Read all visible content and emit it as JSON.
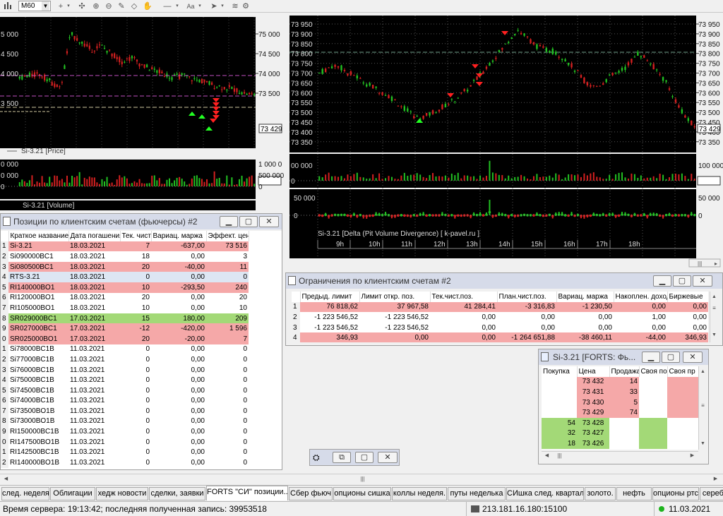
{
  "toolbar": {
    "timeframe": "M60"
  },
  "left_chart": {
    "price_legend": "Si-3.21 [Price]",
    "volume_legend": "Si-3.21 [Volume]",
    "y_ticks_right": [
      "75 000",
      "74 500",
      "74 000",
      "73 500"
    ],
    "y_ticks_left": [
      "5 000",
      "4 500",
      "4 000",
      "3 500"
    ],
    "last_price": "73 429",
    "volume_ticks_right": [
      "1 000 0",
      "500 000",
      "0"
    ],
    "volume_ticks_left": [
      "0 000",
      "0 000",
      "0"
    ]
  },
  "right_chart": {
    "y_ticks": [
      "73 950",
      "73 900",
      "73 850",
      "73 800",
      "73 750",
      "73 700",
      "73 650",
      "73 600",
      "73 550",
      "73 500",
      "73 450",
      "73 400",
      "73 350"
    ],
    "last_price": "73 429",
    "volume_ticks": [
      "100 000",
      "0"
    ],
    "volume_ticks_left": [
      "00 000",
      "0"
    ],
    "delta_ticks": [
      "50 000",
      "0"
    ],
    "delta_ticks_left": [
      "50 000",
      "0"
    ],
    "delta_legend": "Si-3.21 [Delta (Pit Volume Divergence) [ k-pavel.ru ]",
    "hours": [
      "9h",
      "10h",
      "11h",
      "12h",
      "13h",
      "14h",
      "15h",
      "16h",
      "17h",
      "18h"
    ]
  },
  "positions_window": {
    "title": "Позиции по клиентским счетам (фьючерсы) #2",
    "columns": [
      "Краткое название",
      "Дата погашения",
      "Тек. чист",
      "Вариац. маржа",
      "Эффект. цен"
    ],
    "rows": [
      {
        "n": "1",
        "name": "Si-3.21",
        "date": "18.03.2021",
        "net": "7",
        "var": "-637,00",
        "eff": "73 516",
        "style": "pink"
      },
      {
        "n": "2",
        "name": "Si090000BC1",
        "date": "18.03.2021",
        "net": "18",
        "var": "0,00",
        "eff": "3",
        "style": "white"
      },
      {
        "n": "3",
        "name": "Si080500BC1",
        "date": "18.03.2021",
        "net": "20",
        "var": "-40,00",
        "eff": "11",
        "style": "pink"
      },
      {
        "n": "4",
        "name": "RTS-3.21",
        "date": "18.03.2021",
        "net": "0",
        "var": "0,00",
        "eff": "0",
        "style": "sel"
      },
      {
        "n": "5",
        "name": "RI140000BO1",
        "date": "18.03.2021",
        "net": "10",
        "var": "-293,50",
        "eff": "240",
        "style": "pink"
      },
      {
        "n": "6",
        "name": "RI120000BO1",
        "date": "18.03.2021",
        "net": "20",
        "var": "0,00",
        "eff": "20",
        "style": "white"
      },
      {
        "n": "7",
        "name": "RI105000BO1",
        "date": "18.03.2021",
        "net": "10",
        "var": "0,00",
        "eff": "10",
        "style": "white"
      },
      {
        "n": "8",
        "name": "SR029000BC1",
        "date": "17.03.2021",
        "net": "15",
        "var": "180,00",
        "eff": "209",
        "style": "green"
      },
      {
        "n": "9",
        "name": "SR027000BC1",
        "date": "17.03.2021",
        "net": "-12",
        "var": "-420,00",
        "eff": "1 596",
        "style": "pink"
      },
      {
        "n": "0",
        "name": "SR025000BO1",
        "date": "17.03.2021",
        "net": "20",
        "var": "-20,00",
        "eff": "7",
        "style": "pink"
      },
      {
        "n": "1",
        "name": "Si78000BC1B",
        "date": "11.03.2021",
        "net": "0",
        "var": "0,00",
        "eff": "0",
        "style": "white"
      },
      {
        "n": "2",
        "name": "Si77000BC1B",
        "date": "11.03.2021",
        "net": "0",
        "var": "0,00",
        "eff": "0",
        "style": "white"
      },
      {
        "n": "3",
        "name": "Si76000BC1B",
        "date": "11.03.2021",
        "net": "0",
        "var": "0,00",
        "eff": "0",
        "style": "white"
      },
      {
        "n": "4",
        "name": "Si75000BC1B",
        "date": "11.03.2021",
        "net": "0",
        "var": "0,00",
        "eff": "0",
        "style": "white"
      },
      {
        "n": "5",
        "name": "Si74500BC1B",
        "date": "11.03.2021",
        "net": "0",
        "var": "0,00",
        "eff": "0",
        "style": "white"
      },
      {
        "n": "6",
        "name": "Si74000BC1B",
        "date": "11.03.2021",
        "net": "0",
        "var": "0,00",
        "eff": "0",
        "style": "white"
      },
      {
        "n": "7",
        "name": "Si73500BO1B",
        "date": "11.03.2021",
        "net": "0",
        "var": "0,00",
        "eff": "0",
        "style": "white"
      },
      {
        "n": "8",
        "name": "Si73000BO1B",
        "date": "11.03.2021",
        "net": "0",
        "var": "0,00",
        "eff": "0",
        "style": "white"
      },
      {
        "n": "9",
        "name": "RI150000BC1B",
        "date": "11.03.2021",
        "net": "0",
        "var": "0,00",
        "eff": "0",
        "style": "white"
      },
      {
        "n": "0",
        "name": "RI147500BO1B",
        "date": "11.03.2021",
        "net": "0",
        "var": "0,00",
        "eff": "0",
        "style": "white"
      },
      {
        "n": "1",
        "name": "RI142500BC1B",
        "date": "11.03.2021",
        "net": "0",
        "var": "0,00",
        "eff": "0",
        "style": "white"
      },
      {
        "n": "2",
        "name": "RI140000BO1B",
        "date": "11.03.2021",
        "net": "0",
        "var": "0,00",
        "eff": "0",
        "style": "white"
      }
    ]
  },
  "limits_window": {
    "title": "Ограничения по клиентским счетам #2",
    "columns": [
      "Предыд. лимит",
      "Лимит откр. поз.",
      "Тек.чист.поз.",
      "План.чист.поз.",
      "Вариац. маржа",
      "Накоплен. доход",
      "Биржевые"
    ],
    "rows": [
      {
        "n": "1",
        "cells": [
          "76 818,62",
          "37 967,58",
          "41 284,41",
          "-3 316,83",
          "-1 230,50",
          "0,00",
          "0,00"
        ],
        "style": "pink"
      },
      {
        "n": "2",
        "cells": [
          "-1 223 546,52",
          "-1 223 546,52",
          "0,00",
          "0,00",
          "0,00",
          "1,00",
          "0,00"
        ],
        "style": "white"
      },
      {
        "n": "3",
        "cells": [
          "-1 223 546,52",
          "-1 223 546,52",
          "0,00",
          "0,00",
          "0,00",
          "0,00",
          "0,00"
        ],
        "style": "white"
      },
      {
        "n": "4",
        "cells": [
          "346,93",
          "0,00",
          "0,00",
          "-1 264 651,88",
          "-38 460,11",
          "-44,00",
          "346,93"
        ],
        "style": "pink"
      }
    ]
  },
  "orderbook_window": {
    "title": "Si-3.21 [FORTS: Фь...",
    "columns": [
      "Покупка",
      "Цена",
      "Продажа",
      "Своя по",
      "Своя пр"
    ],
    "rows": [
      {
        "buy": "",
        "price": "73 432",
        "sell": "14",
        "side": "ask"
      },
      {
        "buy": "",
        "price": "73 431",
        "sell": "33",
        "side": "ask"
      },
      {
        "buy": "",
        "price": "73 430",
        "sell": "5",
        "side": "ask"
      },
      {
        "buy": "",
        "price": "73 429",
        "sell": "74",
        "side": "ask"
      },
      {
        "buy": "54",
        "price": "73 428",
        "sell": "",
        "side": "bid"
      },
      {
        "buy": "32",
        "price": "73 427",
        "sell": "",
        "side": "bid"
      },
      {
        "buy": "18",
        "price": "73 426",
        "sell": "",
        "side": "bid"
      }
    ]
  },
  "tabs": [
    {
      "label": "след. неделя",
      "active": false
    },
    {
      "label": "Облигации",
      "active": false
    },
    {
      "label": "хедж новости",
      "active": false
    },
    {
      "label": "сделки, заявки",
      "active": false
    },
    {
      "label": "FORTS \"СИ\" позиции...",
      "active": true
    },
    {
      "label": "Сбер фьюч",
      "active": false
    },
    {
      "label": "опционы сишка",
      "active": false
    },
    {
      "label": "коллы неделя.",
      "active": false
    },
    {
      "label": "путы неделька",
      "active": false
    },
    {
      "label": "СИшка след. квартал",
      "active": false
    },
    {
      "label": "золото.",
      "active": false
    },
    {
      "label": "нефть",
      "active": false
    },
    {
      "label": "опционы ртс",
      "active": false
    },
    {
      "label": "серебро",
      "active": false
    }
  ],
  "status": {
    "server_time": "Время сервера: 19:13:42; последняя полученная запись: 39953518",
    "ip": "213.181.16.180:15100",
    "date": "11.03.2021"
  },
  "colors": {
    "pink_row": "#f5a8a8",
    "green_row": "#a3d977",
    "candle_up": "#22c022",
    "candle_down": "#d42020"
  }
}
